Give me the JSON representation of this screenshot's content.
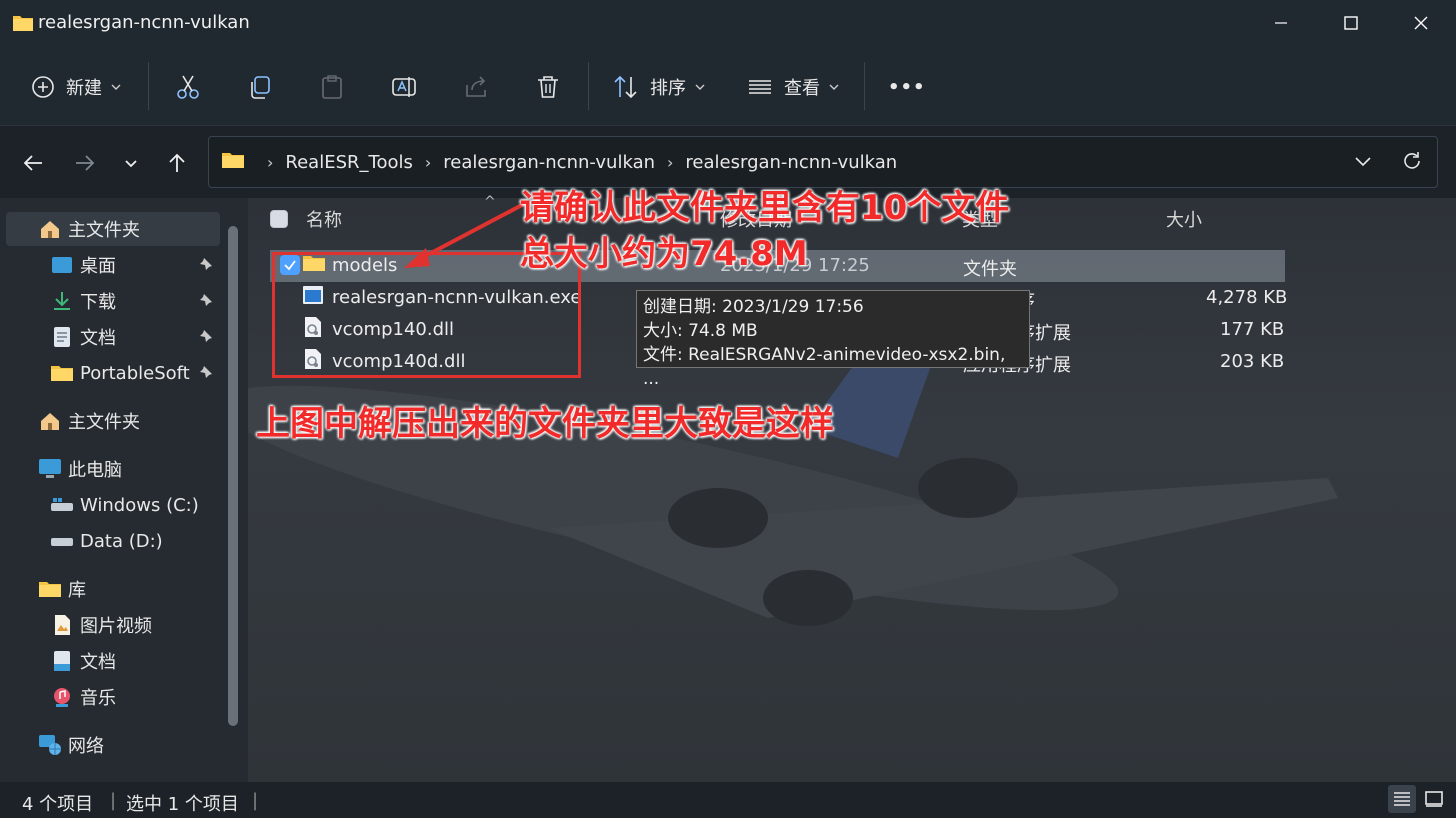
{
  "window": {
    "title": "realesrgan-ncnn-vulkan"
  },
  "toolbar": {
    "new_label": "新建",
    "sort_label": "排序",
    "view_label": "查看",
    "more_label": "•••"
  },
  "address": {
    "crumbs": [
      "RealESR_Tools",
      "realesrgan-ncnn-vulkan",
      "realesrgan-ncnn-vulkan"
    ]
  },
  "sidebar": {
    "items": [
      {
        "label": "主文件夹",
        "icon": "home-icon"
      },
      {
        "label": "桌面",
        "icon": "desktop-icon"
      },
      {
        "label": "下载",
        "icon": "download-icon"
      },
      {
        "label": "文档",
        "icon": "document-icon"
      },
      {
        "label": "PortableSoft",
        "icon": "folder-icon"
      },
      {
        "label": "主文件夹",
        "icon": "home-icon"
      },
      {
        "label": "此电脑",
        "icon": "computer-icon"
      },
      {
        "label": "Windows (C:)",
        "icon": "drive-icon"
      },
      {
        "label": "Data (D:)",
        "icon": "drive-icon"
      },
      {
        "label": "库",
        "icon": "folder-icon"
      },
      {
        "label": "图片视频",
        "icon": "pictures-icon"
      },
      {
        "label": "文档",
        "icon": "document-icon"
      },
      {
        "label": "音乐",
        "icon": "music-icon"
      },
      {
        "label": "网络",
        "icon": "network-icon"
      }
    ]
  },
  "columns": {
    "name": "名称",
    "date": "修改日期",
    "type": "类型",
    "size": "大小"
  },
  "files": [
    {
      "name": "models",
      "date": "2023/1/29 17:25",
      "type": "文件夹",
      "size": ""
    },
    {
      "name": "realesrgan-ncnn-vulkan.exe",
      "date": "",
      "type": "应用程序",
      "size": "4,278 KB"
    },
    {
      "name": "vcomp140.dll",
      "date": "",
      "type": "应用程序扩展",
      "size": "177 KB"
    },
    {
      "name": "vcomp140d.dll",
      "date": "",
      "type": "应用程序扩展",
      "size": "203 KB"
    }
  ],
  "tooltip": {
    "line1": "创建日期: 2023/1/29 17:56",
    "line2": "大小: 74.8 MB",
    "line3": "文件: RealESRGANv2-animevideo-xsx2.bin, ..."
  },
  "annotations": {
    "top_line1": "请确认此文件夹里含有10个文件",
    "top_line2": "总大小约为74.8M",
    "middle": "上图中解压出来的文件夹里大致是这样"
  },
  "status": {
    "count": "4 个项目",
    "selected": "选中 1 个项目"
  },
  "colors": {
    "accent": "#4ea1ff",
    "annotation_red": "#e0322e",
    "folder_yellow": "#f5c542"
  }
}
